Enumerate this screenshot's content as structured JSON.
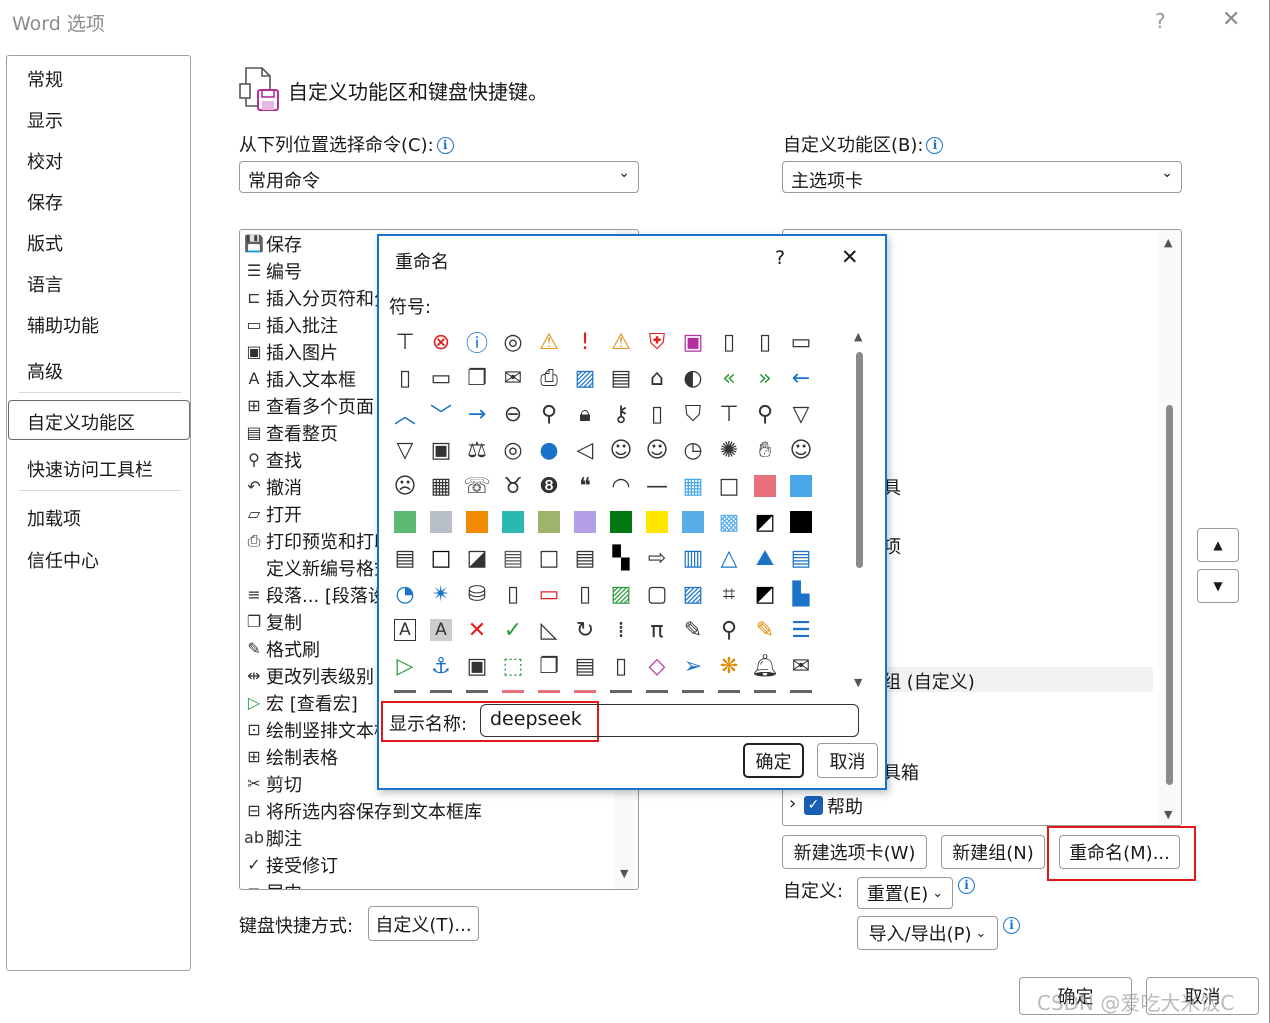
{
  "window": {
    "title": "Word 选项",
    "help": "?",
    "close": "✕"
  },
  "nav": {
    "items": [
      {
        "label": "常规"
      },
      {
        "label": "显示"
      },
      {
        "label": "校对"
      },
      {
        "label": "保存"
      },
      {
        "label": "版式"
      },
      {
        "label": "语言"
      },
      {
        "label": "辅助功能"
      },
      {
        "label": "高级"
      },
      {
        "label": "自定义功能区"
      },
      {
        "label": "快速访问工具栏"
      },
      {
        "label": "加载项"
      },
      {
        "label": "信任中心"
      }
    ],
    "selected": "自定义功能区"
  },
  "header": {
    "title": "自定义功能区和键盘快捷键。"
  },
  "left": {
    "choose_label": "从下列位置选择命令(C):",
    "choose_value": "常用命令",
    "commands": [
      {
        "label": "保存",
        "icon": "save-icon"
      },
      {
        "label": "编号",
        "icon": "numbering-icon"
      },
      {
        "label": "插入分页符和分",
        "icon": "page-break-icon"
      },
      {
        "label": "插入批注",
        "icon": "comment-icon"
      },
      {
        "label": "插入图片",
        "icon": "picture-icon"
      },
      {
        "label": "插入文本框",
        "icon": "textbox-icon"
      },
      {
        "label": "查看多个页面",
        "icon": "multi-page-icon"
      },
      {
        "label": "查看整页",
        "icon": "page-icon"
      },
      {
        "label": "查找",
        "icon": "find-icon"
      },
      {
        "label": "撤消",
        "icon": "undo-icon"
      },
      {
        "label": "打开",
        "icon": "open-icon"
      },
      {
        "label": "打印预览和打印",
        "icon": "print-preview-icon"
      },
      {
        "label": "定义新编号格式",
        "icon": ""
      },
      {
        "label": "段落... [段落设",
        "icon": "paragraph-icon"
      },
      {
        "label": "复制",
        "icon": "copy-icon"
      },
      {
        "label": "格式刷",
        "icon": "format-painter-icon"
      },
      {
        "label": "更改列表级别",
        "icon": "list-level-icon"
      },
      {
        "label": "宏 [查看宏]",
        "icon": "macro-icon"
      },
      {
        "label": "绘制竖排文本框",
        "icon": "vertical-textbox-icon"
      },
      {
        "label": "绘制表格",
        "icon": "draw-table-icon"
      },
      {
        "label": "剪切",
        "icon": "cut-icon"
      },
      {
        "label": "将所选内容保存到文本框库",
        "icon": "save-selection-icon"
      },
      {
        "label": "脚注",
        "icon": "footnote-icon"
      },
      {
        "label": "接受修订",
        "icon": "accept-revision-icon"
      },
      {
        "label": "居中",
        "icon": "center-icon"
      }
    ],
    "keyboard_label": "键盘快捷方式:",
    "keyboard_button": "自定义(T)..."
  },
  "right": {
    "ribbon_label": "自定义功能区(B):",
    "ribbon_value": "主选项卡",
    "visible_fragments": [
      {
        "text": "具"
      },
      {
        "text": "项"
      },
      {
        "text": "组 (自定义)"
      },
      {
        "text": "具箱"
      }
    ],
    "help_item": "帮助",
    "new_tab": "新建选项卡(W)",
    "new_group": "新建组(N)",
    "rename": "重命名(M)...",
    "custom_label": "自定义:",
    "reset": "重置(E)",
    "import_export": "导入/导出(P)"
  },
  "footer": {
    "ok": "确定",
    "cancel": "取消"
  },
  "dialog": {
    "title": "重命名",
    "help": "?",
    "close": "✕",
    "symbols_label": "符号:",
    "display_name_label": "显示名称:",
    "display_name_value": "deepseek",
    "ok": "确定",
    "cancel": "取消",
    "symbols": [
      "hierarchy-icon",
      "error-circle-icon",
      "info-icon",
      "target-icon",
      "warning-icon",
      "exclamation-icon",
      "warning-triangle-icon",
      "shield-icon",
      "save-icon",
      "document-arrow-icon",
      "document-check-icon",
      "folder-icon",
      "blank-document-icon",
      "folder-open-icon",
      "copy-folder-icon",
      "mail-tray-icon",
      "printer-icon",
      "picture-icon",
      "clipboard-icon",
      "home-icon",
      "palette-icon",
      "double-left-arrow-icon",
      "double-right-arrow-icon",
      "left-arrow-icon",
      "chevron-up-icon",
      "chevron-down-icon",
      "right-arrow-icon",
      "circle-left-arrow-icon",
      "pin-icon",
      "lock-icon",
      "key-icon",
      "scroll-icon",
      "bookmark-icon",
      "presentation-icon",
      "magnifier-icon",
      "filter-icon",
      "funnel-icon",
      "id-card-icon",
      "scales-icon",
      "overlap-circles-icon",
      "microphone-icon",
      "mute-icon",
      "user-outline-icon",
      "user-icon",
      "clock-icon",
      "burst-icon",
      "hand-icon",
      "smiley-icon",
      "sad-face-icon",
      "calculator-icon",
      "phone-icon",
      "piggy-bank-icon",
      "eight-ball-icon",
      "quote-icon",
      "eye-icon",
      "dash-icon",
      "color-grid-icon",
      "empty-square-icon",
      "red-square-icon",
      "blue-square-icon",
      "green-square-icon",
      "gray-square-icon",
      "orange-square-icon",
      "teal-square-icon",
      "olive-square-icon",
      "lavender-square-icon",
      "dark-green-square-icon",
      "yellow-square-icon",
      "sky-square-icon",
      "hatched-square-icon",
      "diagonal-split-icon",
      "black-square-icon",
      "gradient-square-icon",
      "bold-border-square-icon",
      "slash-square-icon",
      "gray-gradient-icon",
      "white-square-icon",
      "striped-square-icon",
      "checker-icon",
      "circle-arrow-icon",
      "bar-chart-icon",
      "cone-icon",
      "mountain-chart-icon",
      "bar-align-icon",
      "pie-chart-icon",
      "radar-icon",
      "database-icon",
      "cylinder-icon",
      "presentation-red-icon",
      "signature-doc-icon",
      "landscape-icon",
      "frame-icon",
      "web-picture-icon",
      "crop-icon",
      "contrast-icon",
      "shapes-icon",
      "letter-a-icon",
      "letter-a-shaded-icon",
      "red-x-icon",
      "green-check-icon",
      "ruler-triangle-icon",
      "refresh-icon",
      "binary-icon",
      "pi-icon",
      "highlighter-icon",
      "search-icon",
      "brush-icon",
      "bullet-list-icon",
      "play-icon",
      "anchor-icon",
      "briefcase-icon",
      "dotted-shape-icon",
      "duplicate-icon",
      "list-box-icon",
      "panel-icon",
      "eraser-icon",
      "paper-plane-icon",
      "butterfly-icon",
      "bell-icon",
      "envelope-icon"
    ]
  },
  "colors": {
    "accent_blue": "#1a73c8",
    "highlight_red": "#e01818"
  },
  "watermark": "CSDN @爱吃大米饭C"
}
